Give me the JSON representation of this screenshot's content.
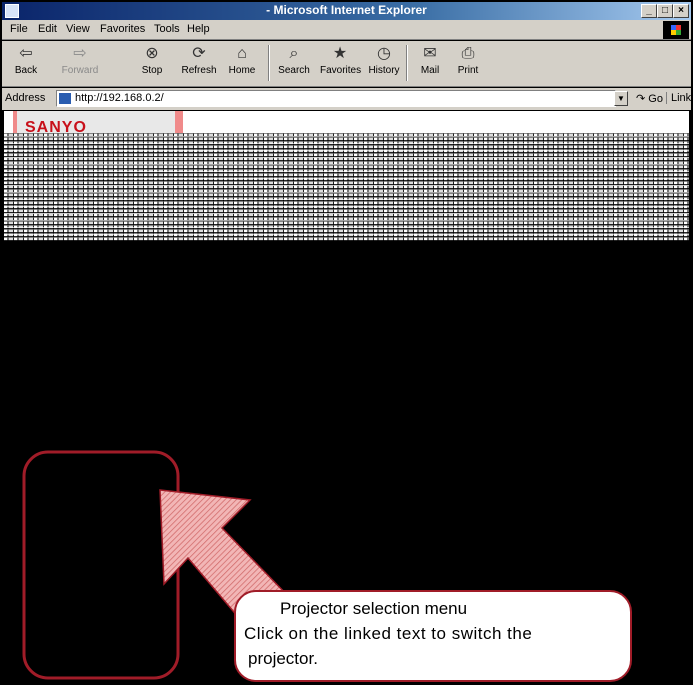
{
  "window": {
    "title": "- Microsoft Internet Explorer",
    "controls": [
      "minimize",
      "maximize",
      "close"
    ]
  },
  "menubar": {
    "items": [
      "File",
      "Edit",
      "View",
      "Favorites",
      "Tools",
      "Help"
    ]
  },
  "toolbar": {
    "buttons": [
      {
        "label": "Back",
        "icon": "back-arrow-icon",
        "enabled": true
      },
      {
        "label": "Forward",
        "icon": "forward-arrow-icon",
        "enabled": false
      },
      {
        "label": "Stop",
        "icon": "stop-icon",
        "enabled": true
      },
      {
        "label": "Refresh",
        "icon": "refresh-icon",
        "enabled": true
      },
      {
        "label": "Home",
        "icon": "home-icon",
        "enabled": true
      },
      {
        "label": "Search",
        "icon": "search-icon",
        "enabled": true
      },
      {
        "label": "Favorites",
        "icon": "favorites-icon",
        "enabled": true
      },
      {
        "label": "History",
        "icon": "history-icon",
        "enabled": true
      },
      {
        "label": "Mail",
        "icon": "mail-icon",
        "enabled": true
      },
      {
        "label": "Print",
        "icon": "print-icon",
        "enabled": true
      }
    ]
  },
  "addressbar": {
    "label": "Address",
    "url": "http://192.168.0.2/",
    "go_label": "Go",
    "links_label": "Links"
  },
  "page": {
    "brand": "SANYO"
  },
  "callout": {
    "title": "Projector selection menu",
    "line2": "Click on the linked text to switch the",
    "line3": "projector."
  },
  "colors": {
    "callout_border": "#a01c28",
    "arrow_fill": "#e88a8a",
    "brand": "#c8101a"
  }
}
